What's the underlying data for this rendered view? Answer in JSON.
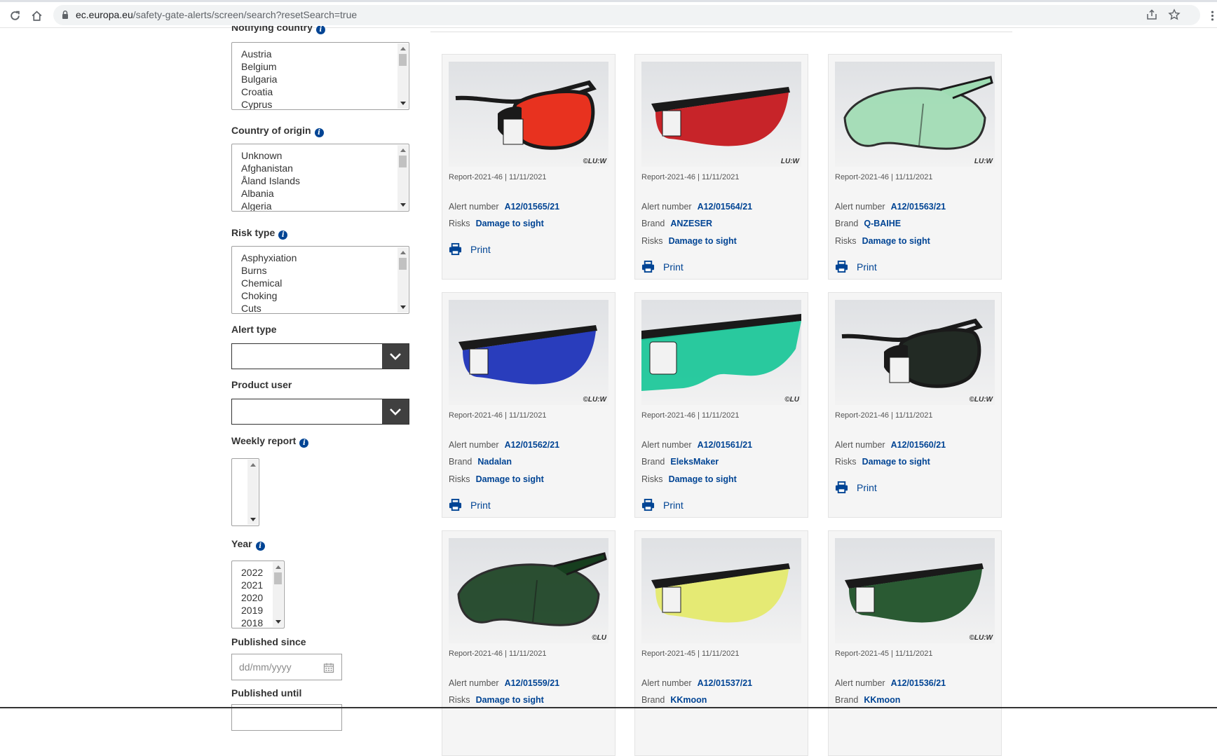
{
  "browser": {
    "url_domain": "ec.europa.eu",
    "url_path": "/safety-gate-alerts/screen/search?resetSearch=true"
  },
  "filters": {
    "notifying_country": {
      "label": "Notifying country",
      "options": [
        "Austria",
        "Belgium",
        "Bulgaria",
        "Croatia",
        "Cyprus"
      ]
    },
    "country_of_origin": {
      "label": "Country of origin",
      "options": [
        "Unknown",
        "Afghanistan",
        "Åland Islands",
        "Albania",
        "Algeria"
      ]
    },
    "risk_type": {
      "label": "Risk type",
      "options": [
        "Asphyxiation",
        "Burns",
        "Chemical",
        "Choking",
        "Cuts"
      ]
    },
    "alert_type": {
      "label": "Alert type",
      "value": ""
    },
    "product_user": {
      "label": "Product user",
      "value": ""
    },
    "weekly_report": {
      "label": "Weekly report"
    },
    "year": {
      "label": "Year",
      "options": [
        "2022",
        "2021",
        "2020",
        "2019",
        "2018"
      ]
    },
    "published_since": {
      "label": "Published since",
      "placeholder": "dd/mm/yyyy"
    },
    "published_until": {
      "label": "Published until"
    }
  },
  "labels": {
    "alert_number": "Alert number",
    "brand": "Brand",
    "risks": "Risks",
    "print": "Print"
  },
  "results": [
    {
      "report": "Report-2021-46 | 11/11/2021",
      "alert": "A12/01565/21",
      "brand": "",
      "risk": "Damage to sight",
      "lens": "#e8321f",
      "style": "side",
      "watermark": "©LU:W",
      "tag": "10a"
    },
    {
      "report": "Report-2021-46 | 11/11/2021",
      "alert": "A12/01564/21",
      "brand": "ANZESER",
      "risk": "Damage to sight",
      "lens": "#c4141a",
      "style": "shield",
      "watermark": "LU:W",
      "tag": "08a"
    },
    {
      "report": "Report-2021-46 | 11/11/2021",
      "alert": "A12/01563/21",
      "brand": "Q-BAIHE",
      "risk": "Damage to sight",
      "lens": "#9fdcb3",
      "style": "over",
      "watermark": "LU:W",
      "tag": ""
    },
    {
      "report": "Report-2021-46 | 11/11/2021",
      "alert": "A12/01562/21",
      "brand": "Nadalan",
      "risk": "Damage to sight",
      "lens": "#1a2fb8",
      "style": "shield",
      "watermark": "©LU:W",
      "tag": "06a"
    },
    {
      "report": "Report-2021-46 | 11/11/2021",
      "alert": "A12/01561/21",
      "brand": "EleksMaker",
      "risk": "Damage to sight",
      "lens": "#1fc79a",
      "style": "wide",
      "watermark": "©LU",
      "tag": "11a"
    },
    {
      "report": "Report-2021-46 | 11/11/2021",
      "alert": "A12/01560/21",
      "brand": "",
      "risk": "Damage to sight",
      "lens": "#222a24",
      "style": "side",
      "watermark": "©LU:W",
      "tag": "09c"
    },
    {
      "report": "Report-2021-46 | 11/11/2021",
      "alert": "A12/01559/21",
      "brand": "",
      "risk": "Damage to sight",
      "lens": "#163e1e",
      "style": "over",
      "watermark": "©LU",
      "tag": "05a"
    },
    {
      "report": "Report-2021-45 | 11/11/2021",
      "alert": "A12/01537/21",
      "brand": "KKmoon",
      "risk": "",
      "lens": "#e4ea6a",
      "style": "shield",
      "watermark": "",
      "tag": "03c"
    },
    {
      "report": "Report-2021-45 | 11/11/2021",
      "alert": "A12/01536/21",
      "brand": "KKmoon",
      "risk": "",
      "lens": "#1b4f25",
      "style": "shield",
      "watermark": "©LU:W",
      "tag": "02c"
    }
  ]
}
